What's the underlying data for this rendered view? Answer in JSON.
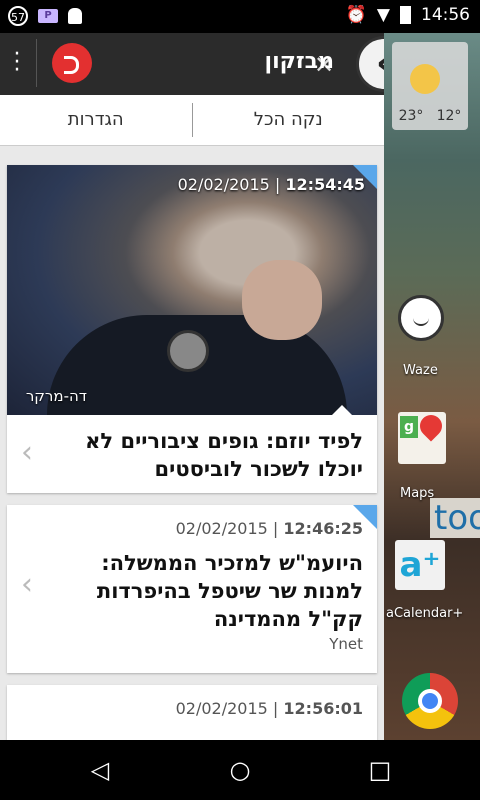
{
  "status_bar": {
    "notif_count": "57",
    "notif_p": "P",
    "time": "14:56"
  },
  "launcher": {
    "temp_high": "23°",
    "temp_low": "12°",
    "waze_label": "Waze",
    "maps_label": "Maps",
    "tool_text": "too",
    "acal_label": "aCalendar+"
  },
  "panel": {
    "title": "מבזקון",
    "tabs": [
      {
        "label": "נקה הכל"
      },
      {
        "label": "הגדרות"
      }
    ]
  },
  "news": [
    {
      "time": "12:54:45",
      "date": "02/02/2015",
      "photo_credit": "דה-מרקר",
      "headline": "לפיד יוזם: גופים ציבוריים לא יוכלו לשכור לוביסטים"
    },
    {
      "time": "12:46:25",
      "date": "02/02/2015",
      "headline": "היועמ\"ש למזכיר הממשלה: למנות שר שיטפל בהיפרדות קק\"ל מהמדינה",
      "source": "Ynet"
    },
    {
      "time": "12:56:01",
      "date": "02/02/2015",
      "headline": ""
    }
  ],
  "colors": {
    "accent_blue": "#5aa7ea",
    "logo_red": "#e33030"
  }
}
